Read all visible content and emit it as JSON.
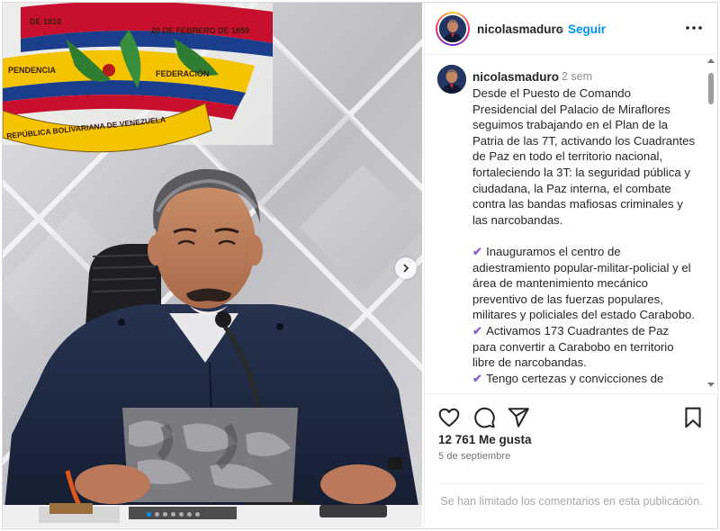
{
  "post": {
    "username": "nicolasmaduro",
    "separator": "•",
    "follow_label": "Seguir",
    "more_icon": "more-horizontal-icon",
    "time_ago": "2 sem",
    "caption": {
      "intro": "Desde el Puesto de Comando Presidencial del Palacio de Miraflores seguimos trabajando en el Plan de la Patria de las 7T, activando los Cuadrantes de Paz en todo el territorio nacional, fortaleciendo la 3T: la seguridad pública y ciudadana, la Paz interna, el combate contra las bandas mafiosas criminales y las narcobandas.",
      "check_mark": "✔",
      "bullets": [
        "Inauguramos el centro de adiestramiento popular-militar-policial y el área de mantenimiento mecánico preventivo de las fuerzas populares, militares y policiales del estado Carabobo.",
        "Activamos 173 Cuadrantes de Paz para convertir a Carabobo en territorio libre de narcobandas.",
        "Tengo certezas y convicciones de"
      ]
    },
    "likes": "12 761 Me gusta",
    "date": "5 de septiembre",
    "comments_notice": "Se han limitado los comentarios en esta publicación."
  },
  "media": {
    "emblem_text_left": "DE 1810",
    "emblem_text_right": "20 DE FEBRERO DE 1859",
    "emblem_ribbon_left": "PENDENCIA",
    "emblem_ribbon_right": "FEDERACIÓN",
    "emblem_banner": "REPÚBLICA BOLIVARIANA DE VENEZUELA",
    "carousel_dots": 7,
    "active_dot": 0
  },
  "icons": {
    "like": "heart-icon",
    "comment": "comment-icon",
    "share": "share-icon",
    "save": "bookmark-icon",
    "next": "chevron-right-icon"
  },
  "colors": {
    "link_blue": "#0095f6",
    "text": "#262626",
    "muted": "#737373",
    "check_purple": "#8a5fd1"
  }
}
